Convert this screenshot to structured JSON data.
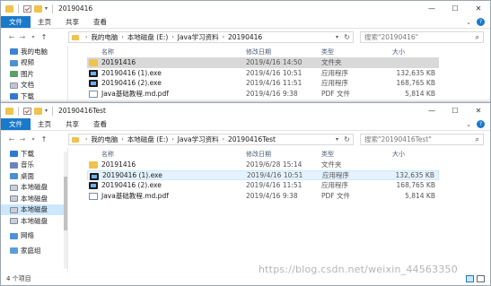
{
  "win1": {
    "title": "20190416",
    "ribbon": [
      "文件",
      "主页",
      "共享",
      "查看"
    ],
    "breadcrumb": [
      "我的电脑",
      "本地磁盘 (E:)",
      "Java学习资料",
      "20190416"
    ],
    "search_placeholder": "搜索\"20190416\"",
    "columns": {
      "name": "名称",
      "date": "修改日期",
      "type": "类型",
      "size": "大小"
    },
    "nav": [
      {
        "label": "我的电脑",
        "icon": "computer-icon"
      },
      {
        "label": "视频",
        "icon": "video-icon"
      },
      {
        "label": "图片",
        "icon": "pictures-icon"
      },
      {
        "label": "文档",
        "icon": "documents-icon"
      },
      {
        "label": "下载",
        "icon": "downloads-icon"
      }
    ],
    "files": [
      {
        "name": "20191416",
        "date": "2019/4/16 14:50",
        "type": "文件夹",
        "size": "",
        "icon": "folder-icon"
      },
      {
        "name": "20190416 (1).exe",
        "date": "2019/4/16 10:51",
        "type": "应用程序",
        "size": "132,635 KB",
        "icon": "exe-icon"
      },
      {
        "name": "20190416 (2).exe",
        "date": "2019/4/16 11:51",
        "type": "应用程序",
        "size": "168,765 KB",
        "icon": "exe-icon"
      },
      {
        "name": "Java基础教程.md.pdf",
        "date": "2019/4/16 9:38",
        "type": "PDF 文件",
        "size": "5,814 KB",
        "icon": "pdf-icon"
      }
    ]
  },
  "win2": {
    "title": "20190416Test",
    "ribbon": [
      "文件",
      "主页",
      "共享",
      "查看"
    ],
    "breadcrumb": [
      "我的电脑",
      "本地磁盘 (E:)",
      "Java学习资料",
      "20190416Test"
    ],
    "search_placeholder": "搜索\"20190416Test\"",
    "columns": {
      "name": "名称",
      "date": "修改日期",
      "type": "类型",
      "size": "大小"
    },
    "nav": [
      {
        "label": "下载",
        "icon": "downloads-icon"
      },
      {
        "label": "音乐",
        "icon": "music-icon"
      },
      {
        "label": "桌面",
        "icon": "desktop-icon"
      },
      {
        "label": "本地磁盘",
        "icon": "drive-icon"
      },
      {
        "label": "本地磁盘",
        "icon": "drive-icon"
      },
      {
        "label": "本地磁盘",
        "icon": "drive-icon"
      },
      {
        "label": "本地磁盘",
        "icon": "drive-icon"
      },
      {
        "label": "网络",
        "icon": "network-icon"
      },
      {
        "label": "家庭组",
        "icon": "homegroup-icon"
      }
    ],
    "files": [
      {
        "name": "20191416",
        "date": "2019/6/28 15:14",
        "type": "文件夹",
        "size": "",
        "icon": "folder-icon"
      },
      {
        "name": "20190416 (1).exe",
        "date": "2019/4/16 10:51",
        "type": "应用程序",
        "size": "132,635 KB",
        "icon": "exe-icon"
      },
      {
        "name": "20190416 (2).exe",
        "date": "2019/4/16 11:51",
        "type": "应用程序",
        "size": "168,765 KB",
        "icon": "exe-icon"
      },
      {
        "name": "Java基础教程.md.pdf",
        "date": "2019/4/16 9:38",
        "type": "PDF 文件",
        "size": "5,814 KB",
        "icon": "pdf-icon"
      }
    ],
    "status": "4 个项目"
  },
  "watermark": "https://blog.csdn.net/weixin_44563350",
  "colors": {
    "accent": "#1979ca",
    "selection": "#cce8ff",
    "folder": "#f0c24e"
  }
}
